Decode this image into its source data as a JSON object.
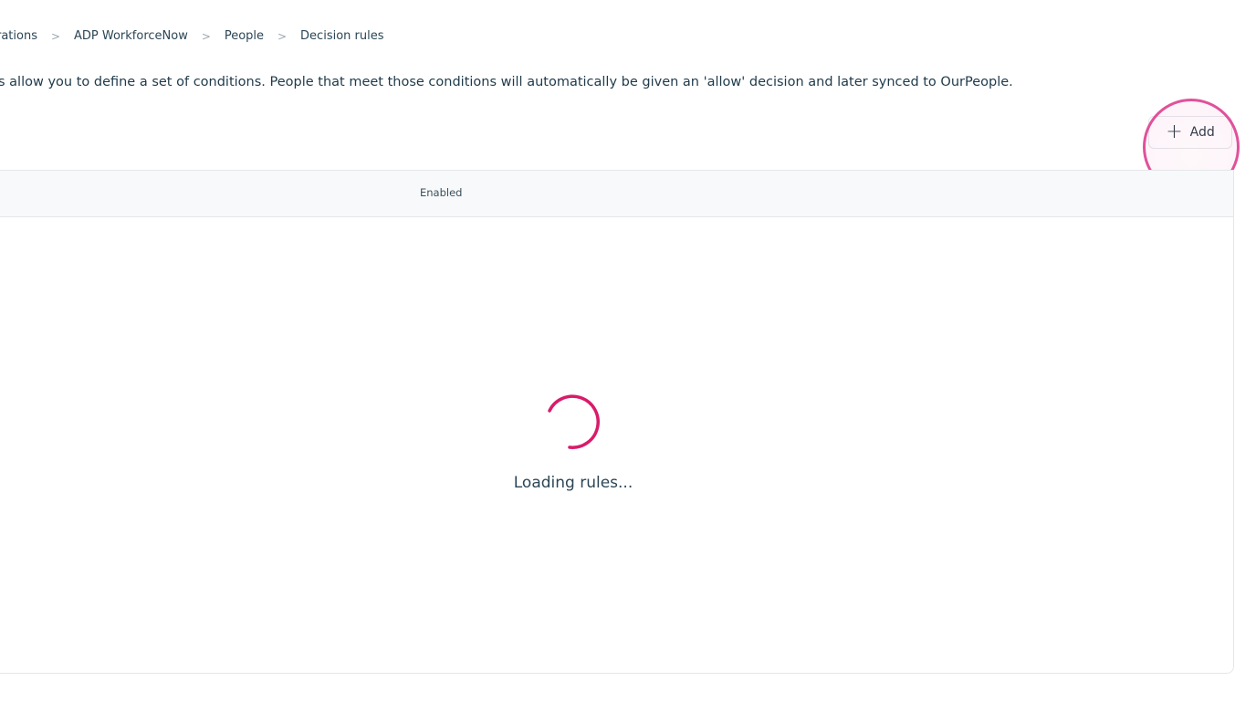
{
  "breadcrumb": {
    "items": [
      {
        "label": "rations"
      },
      {
        "label": "ADP WorkforceNow"
      },
      {
        "label": "People"
      },
      {
        "label": "Decision rules"
      }
    ],
    "separator": ">"
  },
  "description": "s allow you to define a set of conditions. People that meet those conditions will automatically be given an 'allow' decision and later synced to OurPeople.",
  "toolbar": {
    "add_label": "Add",
    "add_icon": "plus-icon"
  },
  "table": {
    "columns": [
      "Enabled"
    ]
  },
  "loading": {
    "text": "Loading rules...",
    "spinner_icon": "spinner-icon"
  },
  "colors": {
    "accent": "#d81b6a",
    "highlight": "#e0519b",
    "text": "#1f3a4a"
  }
}
